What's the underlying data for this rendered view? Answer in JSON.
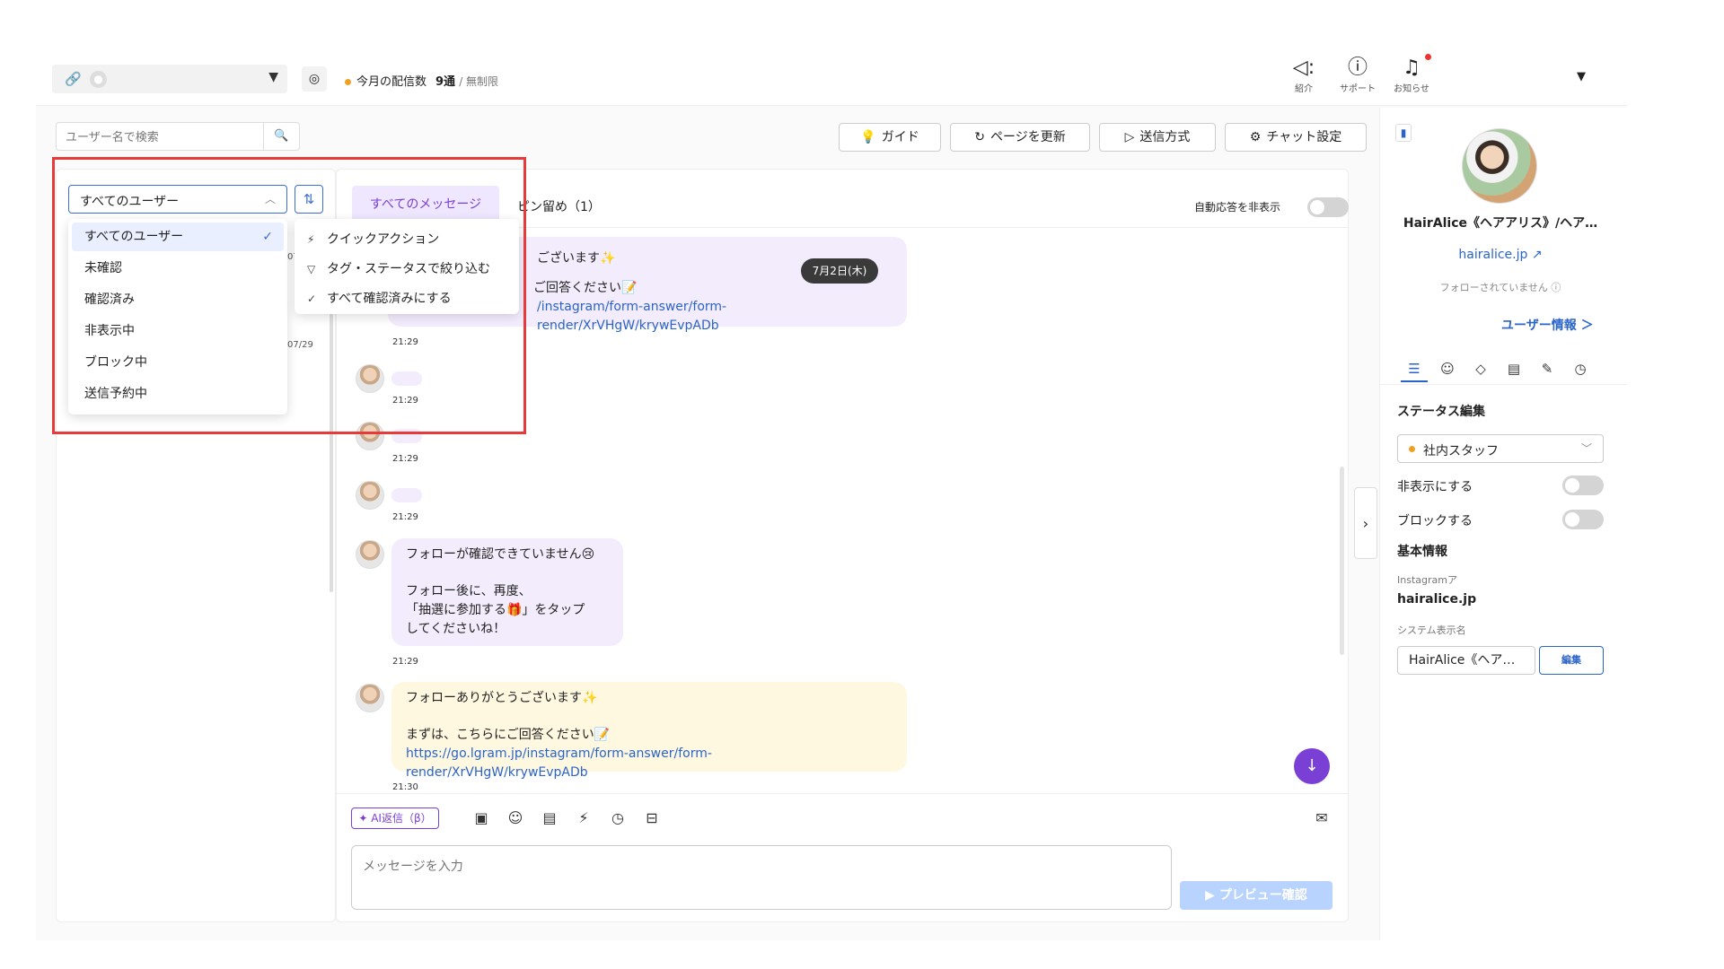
{
  "header": {
    "usage_label": "今月の配信数",
    "usage_count": "9通",
    "usage_limit": "/ 無制限",
    "icons": [
      {
        "name": "megaphone-icon",
        "glyph": "📢",
        "label": "紹介"
      },
      {
        "name": "help-icon",
        "glyph": "?",
        "label": "サポート"
      },
      {
        "name": "bell-icon",
        "glyph": "🔔",
        "label": "お知らせ"
      }
    ]
  },
  "search": {
    "placeholder": "ユーザー名で検索"
  },
  "filter": {
    "selected": "すべてのユーザー",
    "options": [
      "すべてのユーザー",
      "未確認",
      "確認済み",
      "非表示中",
      "ブロック中",
      "送信予約中"
    ]
  },
  "quick_menu": {
    "items": [
      "クイックアクション",
      "タグ・ステータスで絞り込む",
      "すべて確認済みにする"
    ]
  },
  "list": {
    "dates": [
      "07",
      "07/29"
    ]
  },
  "toolbar": {
    "guide": "ガイド",
    "refresh": "ページを更新",
    "send_method": "送信方式",
    "chat_settings": "チャット設定"
  },
  "chat": {
    "tabs": {
      "all": "すべてのメッセージ",
      "pinned": "ピン留め（1）"
    },
    "auto_reply_label": "自動応答を非表示",
    "date_pill": "7月2日(木)",
    "first_bubble": {
      "line1": "ございます✨",
      "line2": "ご回答ください📝",
      "link": "/instagram/form-answer/form-render/XrVHgW/krywEvpADb"
    },
    "times": [
      "21:29",
      "21:29",
      "21:29",
      "21:29",
      "21:29",
      "21:29",
      "21:30"
    ],
    "follow_bubble": {
      "line1": "フォローが確認できていません😢",
      "line2": "フォロー後に、再度、",
      "line3": "「抽選に参加する🎁」をタップ",
      "line4": "してくださいね！"
    },
    "thanks_bubble": {
      "line1": "フォローありがとうございます✨",
      "line2": "まずは、こちらにご回答ください📝",
      "link": "https://go.lgram.jp/instagram/form-answer/form-render/XrVHgW/krywEvpADb"
    }
  },
  "composer": {
    "ai_label": "AI返信（β）",
    "placeholder": "メッセージを入力",
    "preview_label": "プレビュー確認"
  },
  "profile": {
    "name": "HairAlice《ヘアアリス》/ヘア…",
    "handle": "hairalice.jp",
    "follow_status": "フォローされていません ⓘ",
    "user_info_link": "ユーザー情報 ＞",
    "status_heading": "ステータス編集",
    "status_value": "社内スタッフ",
    "hide_label": "非表示にする",
    "block_label": "ブロックする",
    "basic_info_heading": "基本情報",
    "instagram_label": "Instagramア",
    "instagram_value": "hairalice.jp",
    "system_name_label": "システム表示名",
    "system_name_value": "HairAlice《ヘア…",
    "edit_label": "編集"
  },
  "colors": {
    "accent_purple": "#7a3fd4",
    "accent_blue": "#3b6fd6",
    "highlight_red": "#e53b3b",
    "status_orange": "#f0a020"
  }
}
